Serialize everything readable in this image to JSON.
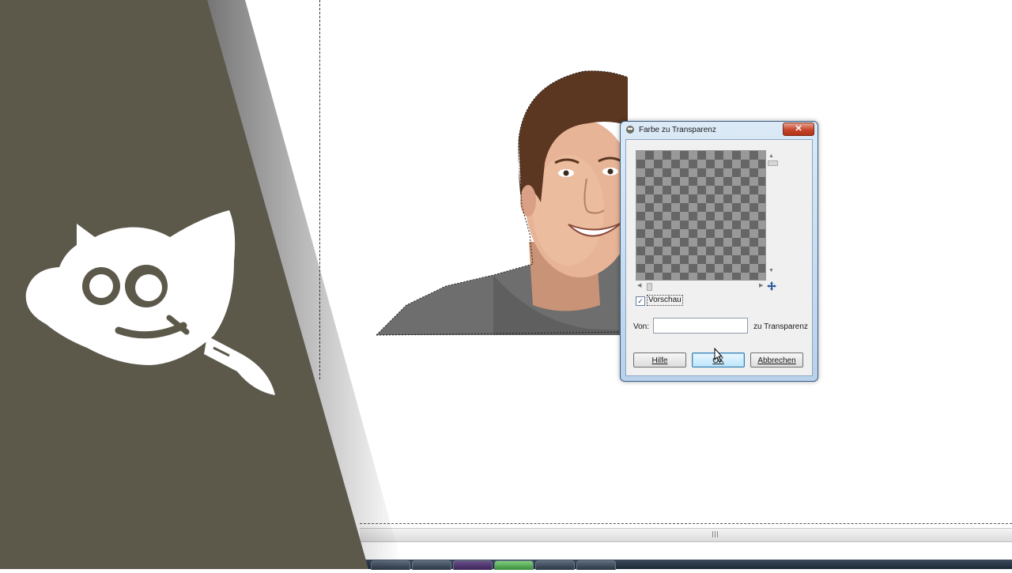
{
  "dialog": {
    "title": "Farbe zu Transparenz",
    "close_label": "✕",
    "preview_checkbox": {
      "checked": true,
      "mark": "✓",
      "label": "Vorschau"
    },
    "from_label": "Von:",
    "from_value": "",
    "to_label": "zu Transparenz",
    "buttons": {
      "help": "Hilfe",
      "ok": "OK",
      "cancel": "Abbrechen"
    }
  },
  "icons": {
    "logo": "gimp-wilber-logo",
    "dialog_icon": "gimp-icon",
    "navigate": "move-cross-icon"
  },
  "colors": {
    "banner": "#5c584a",
    "dialog_frame": "#b9d1ea",
    "close_button": "#c4452a"
  }
}
